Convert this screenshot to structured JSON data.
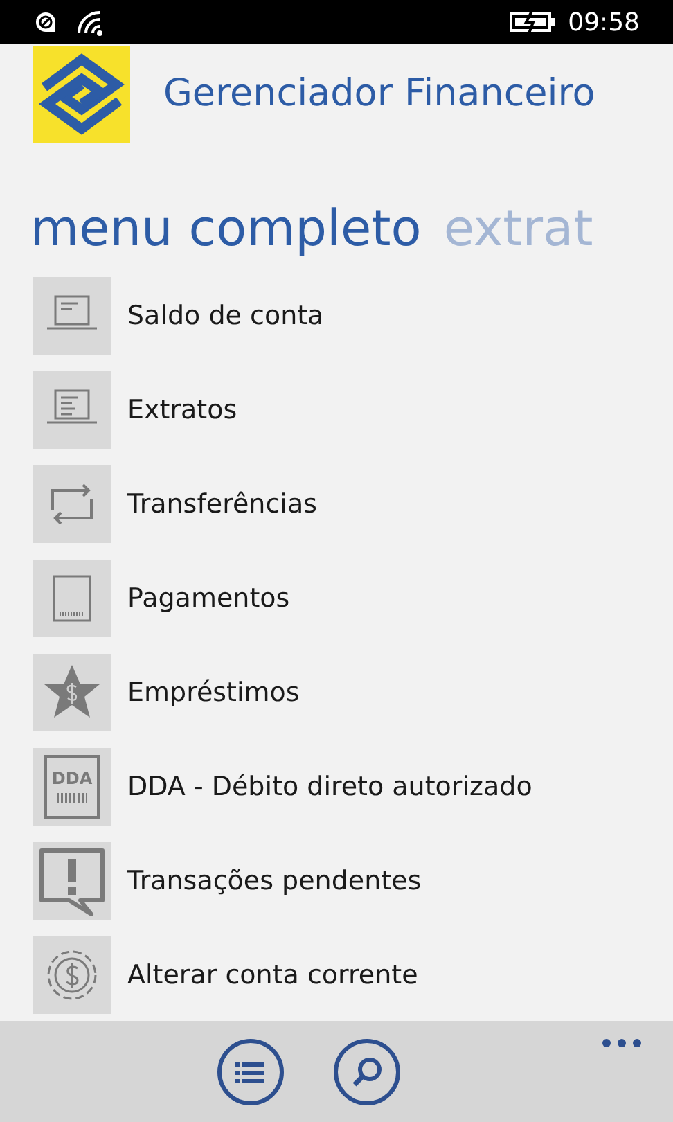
{
  "status_bar": {
    "time": "09:58"
  },
  "header": {
    "title": "Gerenciador Financeiro"
  },
  "pivot": [
    {
      "label": "menu completo",
      "selected": true
    },
    {
      "label": "extrat",
      "selected": false
    }
  ],
  "menu": [
    {
      "label": "Saldo de conta",
      "kind": "balance"
    },
    {
      "label": "Extratos",
      "kind": "statement"
    },
    {
      "label": "Transferências",
      "kind": "transfer"
    },
    {
      "label": "Pagamentos",
      "kind": "payment"
    },
    {
      "label": "Empréstimos",
      "kind": "loan"
    },
    {
      "label": "DDA - Débito direto autorizado",
      "kind": "dda",
      "icon_text": "DDA"
    },
    {
      "label": "Transações pendentes",
      "kind": "pending"
    },
    {
      "label": "Alterar conta corrente",
      "kind": "account"
    }
  ]
}
